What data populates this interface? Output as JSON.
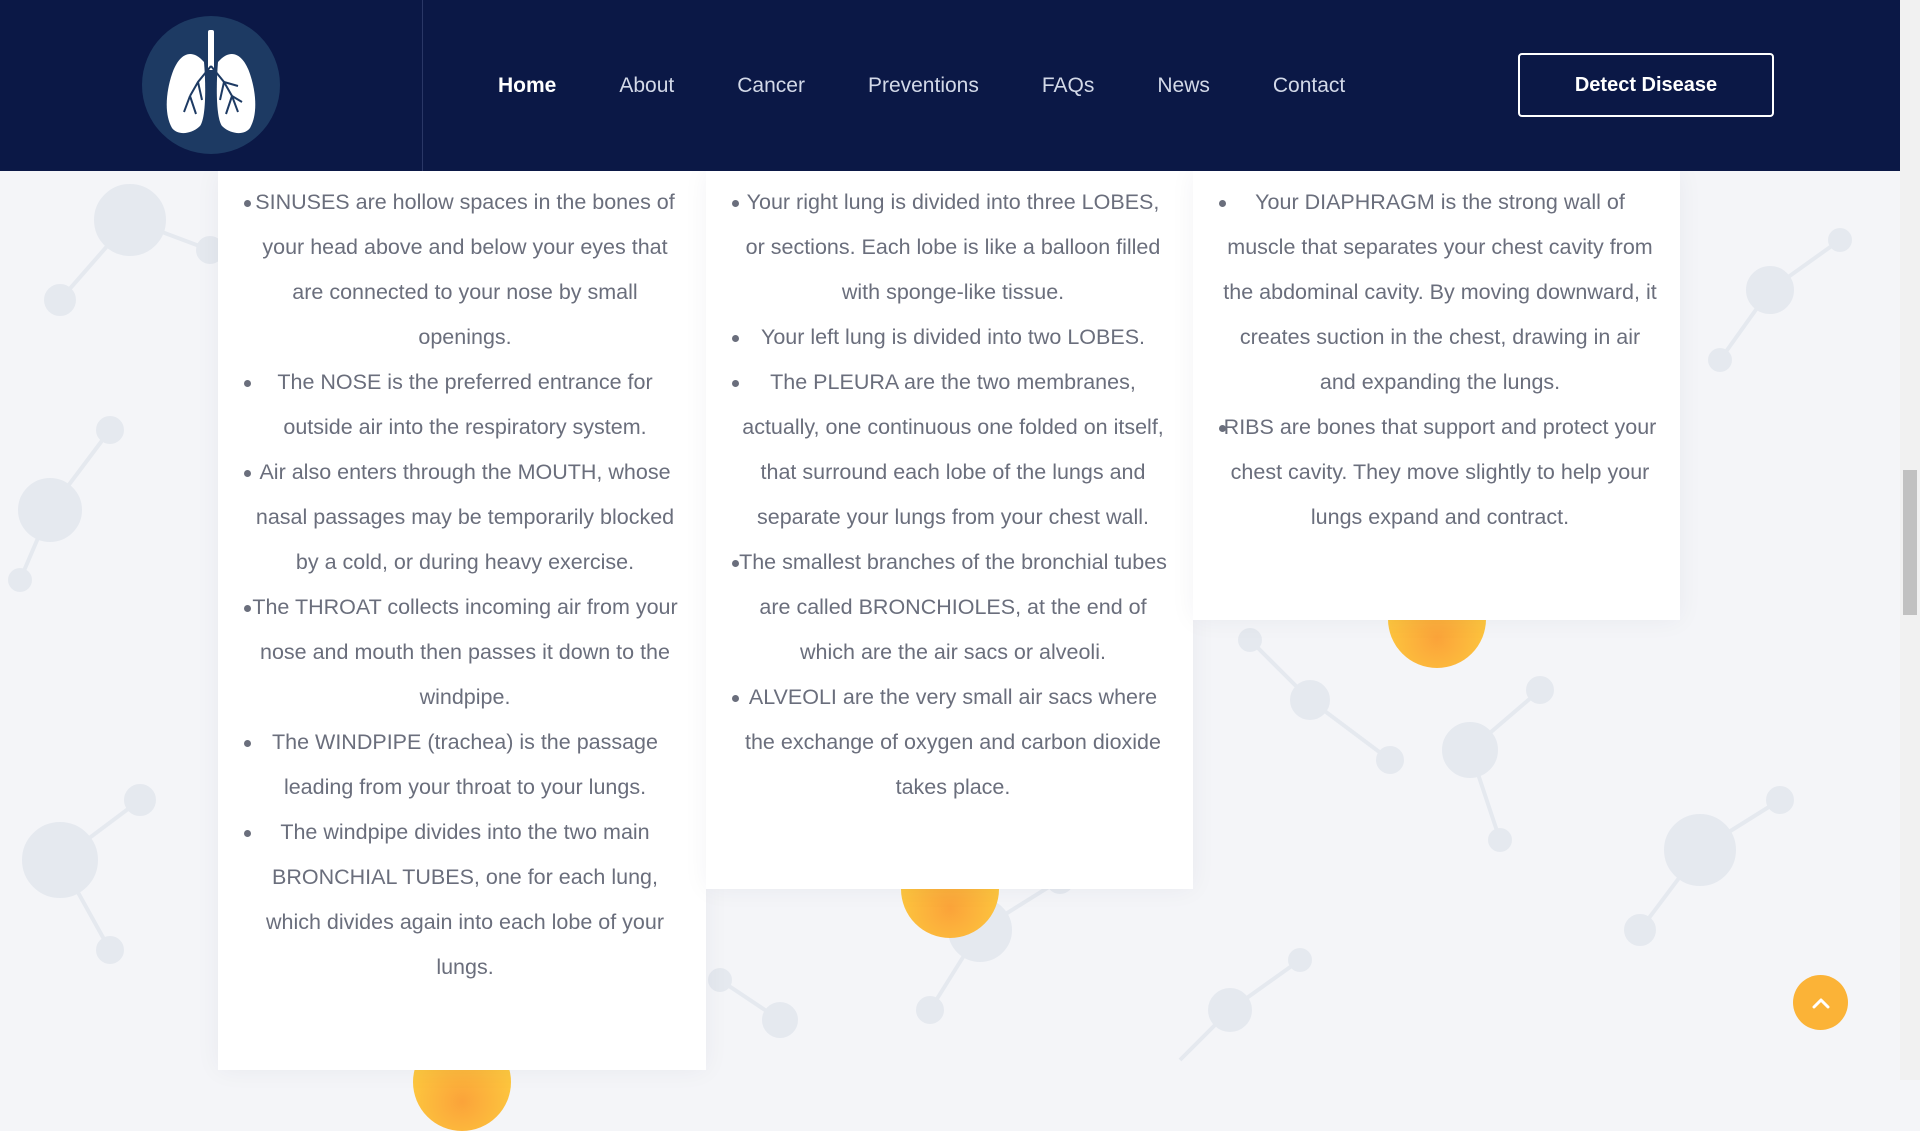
{
  "header": {
    "logo_icon": "lungs-icon",
    "nav": [
      {
        "label": "Home",
        "active": true
      },
      {
        "label": "About"
      },
      {
        "label": "Cancer"
      },
      {
        "label": "Preventions"
      },
      {
        "label": "FAQs"
      },
      {
        "label": "News"
      },
      {
        "label": "Contact"
      }
    ],
    "cta_label": "Detect Disease"
  },
  "columns": [
    {
      "items": [
        "SINUSES are hollow spaces in the bones of your head above and below your eyes that are connected to your nose by small openings.",
        "The NOSE is the preferred entrance for outside air into the respiratory system.",
        "Air also enters through the MOUTH, whose nasal passages may be temporarily blocked by a cold, or during heavy exercise.",
        "The THROAT collects incoming air from your nose and mouth then passes it down to the windpipe.",
        "The WINDPIPE (trachea) is the passage leading from your throat to your lungs.",
        "The windpipe divides into the two main BRONCHIAL TUBES, one for each lung, which divides again into each lobe of your lungs."
      ]
    },
    {
      "items": [
        "Your right lung is divided into three LOBES, or sections. Each lobe is like a balloon filled with sponge-like tissue.",
        "Your left lung is divided into two LOBES.",
        "The PLEURA are the two membranes, actually, one continuous one folded on itself, that surround each lobe of the lungs and separate your lungs from your chest wall.",
        "The smallest branches of the bronchial tubes are called BRONCHIOLES, at the end of which are the air sacs or alveoli.",
        "ALVEOLI are the very small air sacs where the exchange of oxygen and carbon dioxide takes place."
      ]
    },
    {
      "items": [
        "Your DIAPHRAGM is the strong wall of muscle that separates your chest cavity from the abdominal cavity. By moving downward, it creates suction in the chest, drawing in air and expanding the lungs.",
        "RIBS are bones that support and protect your chest cavity. They move slightly to help your lungs expand and contract."
      ]
    }
  ],
  "back_to_top_icon": "chevron-up-icon",
  "colors": {
    "header_bg": "#0b1846",
    "accent": "#fdc53e",
    "text": "#6a6e7c"
  }
}
